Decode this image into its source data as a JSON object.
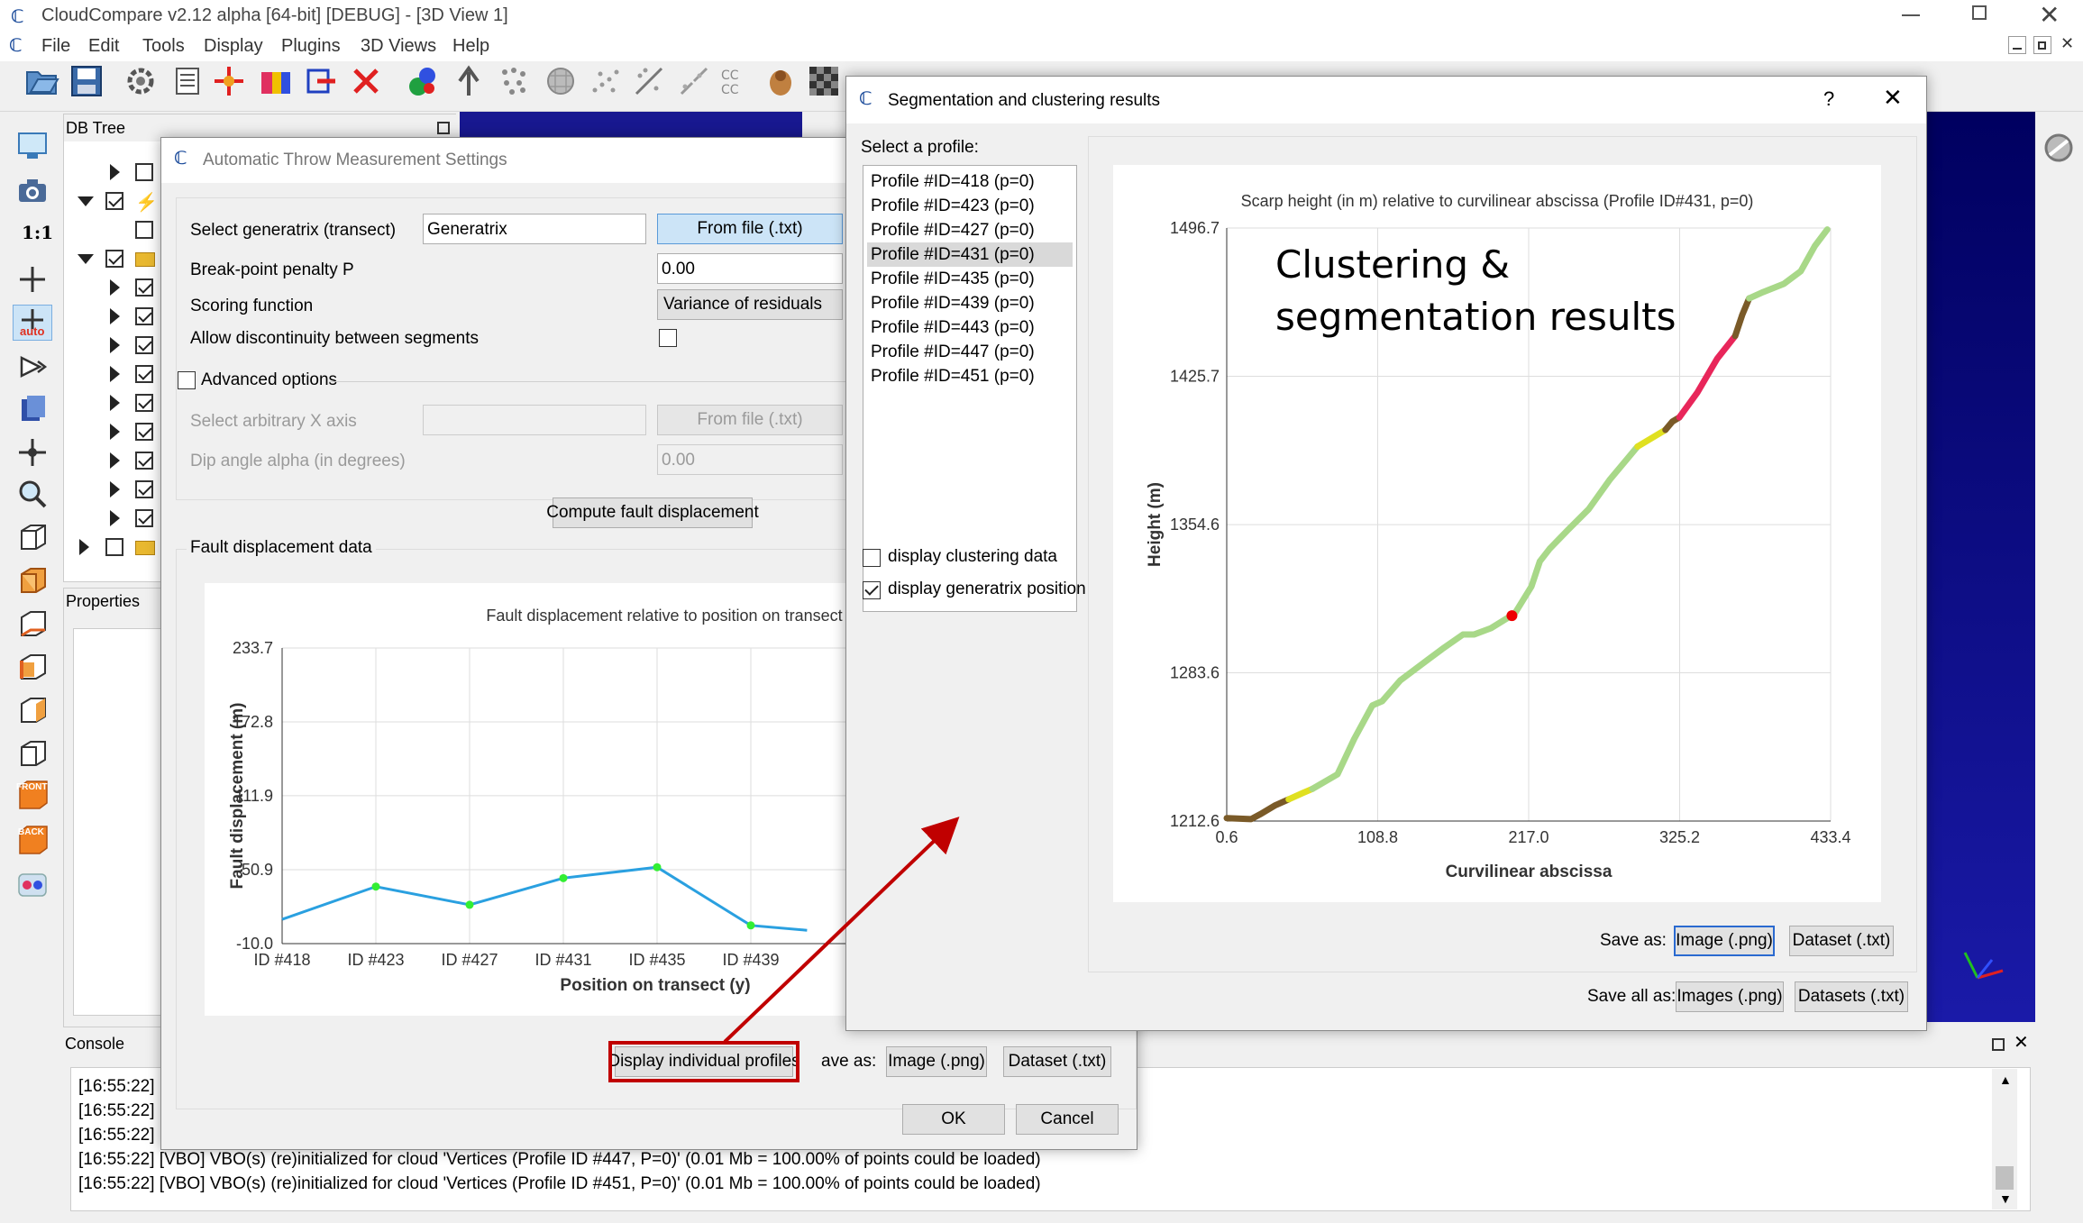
{
  "app": {
    "title": "CloudCompare v2.12 alpha [64-bit] [DEBUG] - [3D View 1]",
    "menu": [
      "File",
      "Edit",
      "Tools",
      "Display",
      "Plugins",
      "3D Views",
      "Help"
    ]
  },
  "db_tree": {
    "title": "DB Tree"
  },
  "properties": {
    "title": "Properties"
  },
  "console": {
    "title": "Console",
    "lines": [
      "[16:55:22] [",
      "[16:55:22] [",
      "[16:55:22] [",
      "[16:55:22] [VBO] VBO(s) (re)initialized for cloud 'Vertices (Profile ID #447, P=0)' (0.01 Mb = 100.00% of points could be loaded)",
      "[16:55:22] [VBO] VBO(s) (re)initialized for cloud 'Vertices (Profile ID #451, P=0)' (0.01 Mb = 100.00% of points could be loaded)"
    ]
  },
  "left_tools": {
    "scale_label": "1:1",
    "auto_label": "auto",
    "front_label": "FRONT",
    "back_label": "BACK"
  },
  "throw_dialog": {
    "title": "Automatic Throw Measurement Settings",
    "generatrix_label": "Select generatrix (transect)",
    "generatrix_value": "Generatrix",
    "from_file": "From file (.txt)",
    "penalty_label": "Break-point penalty P",
    "penalty_value": "0.00",
    "scoring_label": "Scoring function",
    "scoring_value": "Variance of residuals",
    "discontinuity_label": "Allow discontinuity between segments",
    "advanced_label": "Advanced options",
    "xaxis_label": "Select arbitrary X axis",
    "xaxis_from_file": "From file (.txt)",
    "dip_label": "Dip angle alpha (in degrees)",
    "dip_value": "0.00",
    "compute_button": "Compute fault displacement",
    "data_group": "Fault displacement data",
    "display_profiles_button": "Display individual profiles",
    "save_as": "ave as:",
    "image_button": "Image (.png)",
    "dataset_button": "Dataset (.txt)",
    "ok": "OK",
    "cancel": "Cancel"
  },
  "seg_dialog": {
    "title": "Segmentation and clustering results",
    "help": "?",
    "select_profile": "Select a profile:",
    "profiles": [
      "Profile #ID=418 (p=0)",
      "Profile #ID=423 (p=0)",
      "Profile #ID=427 (p=0)",
      "Profile #ID=431 (p=0)",
      "Profile #ID=435 (p=0)",
      "Profile #ID=439 (p=0)",
      "Profile #ID=443 (p=0)",
      "Profile #ID=447 (p=0)",
      "Profile #ID=451 (p=0)"
    ],
    "selected_profile": "Profile #ID=431 (p=0)",
    "display_clustering": "display clustering data",
    "display_generatrix": "display generatrix position",
    "save_as": "Save as:",
    "image_button": "Image (.png)",
    "dataset_button": "Dataset (.txt)",
    "save_all_as": "Save all as:",
    "images_button": "Images (.png)",
    "datasets_button": "Datasets (.txt)",
    "annotation_line1": "Clustering &",
    "annotation_line2": "segmentation results"
  },
  "colors": {
    "accent_blue": "#cce4f7",
    "annotation_red": "#c00000",
    "segment_green": "#a8d888",
    "segment_red": "#e8265a",
    "segment_brown": "#7a5a28",
    "segment_yellow": "#e0e020",
    "line_blue": "#2aa0e0",
    "point_green": "#33ee33",
    "viewport_blue": "#10108a"
  },
  "chart_data": [
    {
      "type": "line",
      "title": "Fault displacement relative to position on transect",
      "xlabel": "Position on transect (y)",
      "ylabel": "Fault displacement (m)",
      "categories": [
        "ID #418",
        "ID #423",
        "ID #427",
        "ID #431",
        "ID #435",
        "ID #439"
      ],
      "yticks": [
        "233.7",
        "172.8",
        "111.9",
        "50.9",
        "-10.0"
      ],
      "ylim": [
        -10.0,
        233.7
      ],
      "values": [
        10,
        37,
        22,
        44,
        53,
        5,
        1
      ],
      "grid": true
    },
    {
      "type": "scatter",
      "title": "Scarp height (in m) relative to curvilinear abscissa (Profile ID#431, p=0)",
      "xlabel": "Curvilinear abscissa",
      "ylabel": "Height (m)",
      "xticks": [
        "0.6",
        "108.8",
        "217.0",
        "325.2",
        "433.4"
      ],
      "yticks": [
        "1496.7",
        "1425.7",
        "1354.6",
        "1283.6",
        "1212.6"
      ],
      "xlim": [
        0.6,
        433.4
      ],
      "ylim": [
        1212.6,
        1496.7
      ],
      "grid": true,
      "segments": [
        {
          "cluster": "brown",
          "points": [
            [
              0.6,
              1214
            ],
            [
              18,
              1213.5
            ],
            [
              25,
              1216
            ],
            [
              35,
              1220
            ],
            [
              45,
              1223
            ]
          ]
        },
        {
          "cluster": "yellow",
          "points": [
            [
              45,
              1223
            ],
            [
              55,
              1226
            ],
            [
              62,
              1228
            ]
          ]
        },
        {
          "cluster": "green",
          "points": [
            [
              62,
              1228
            ],
            [
              80,
              1235
            ],
            [
              92,
              1252
            ],
            [
              105,
              1268
            ],
            [
              112,
              1270
            ],
            [
              125,
              1280
            ],
            [
              145,
              1290
            ],
            [
              155,
              1295
            ],
            [
              170,
              1302
            ],
            [
              178,
              1302
            ],
            [
              190,
              1305
            ],
            [
              207,
              1312
            ],
            [
              219,
              1325
            ],
            [
              225,
              1337
            ],
            [
              232,
              1343
            ],
            [
              245,
              1352
            ],
            [
              260,
              1362
            ],
            [
              275,
              1376
            ],
            [
              290,
              1388
            ],
            [
              295,
              1392
            ]
          ]
        },
        {
          "cluster": "yellow",
          "points": [
            [
              295,
              1392
            ],
            [
              305,
              1396
            ],
            [
              315,
              1400
            ]
          ]
        },
        {
          "cluster": "brown",
          "points": [
            [
              315,
              1400
            ],
            [
              320,
              1404
            ],
            [
              325,
              1406
            ]
          ]
        },
        {
          "cluster": "red",
          "points": [
            [
              325,
              1406
            ],
            [
              338,
              1418
            ],
            [
              352,
              1434
            ],
            [
              365,
              1445
            ]
          ]
        },
        {
          "cluster": "brown",
          "points": [
            [
              365,
              1445
            ],
            [
              370,
              1455
            ],
            [
              375,
              1463
            ]
          ]
        },
        {
          "cluster": "green",
          "points": [
            [
              375,
              1463
            ],
            [
              385,
              1466
            ],
            [
              400,
              1470
            ],
            [
              412,
              1476
            ],
            [
              422,
              1488
            ],
            [
              431,
              1496
            ]
          ]
        }
      ],
      "generatrix_point": [
        205,
        1311
      ]
    }
  ]
}
